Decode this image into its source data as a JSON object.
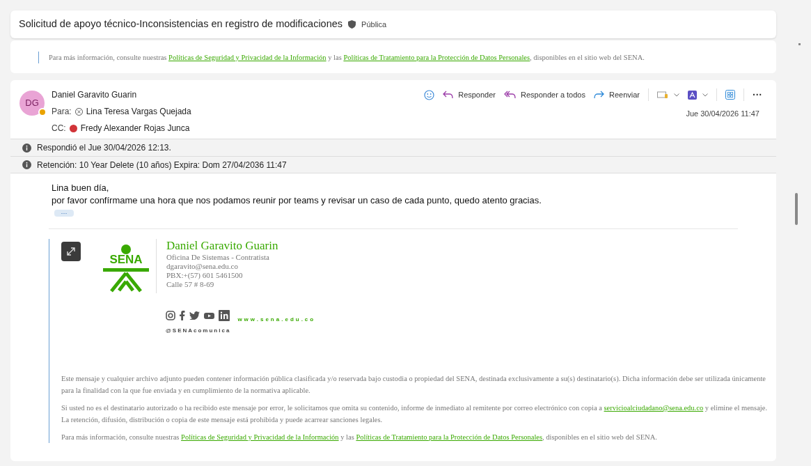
{
  "subject": {
    "title": "Solicitud de apoyo técnico-Inconsistencias en registro de modificaciones",
    "sensitivity": "Pública"
  },
  "previous_message": {
    "paragraphs": [
      {
        "lines": [
          [
            {
              "kind": "text",
              "text": "Para más información, consulte nuestras "
            },
            {
              "kind": "link",
              "text": "Políticas de Seguridad y Privacidad de la Información"
            },
            {
              "kind": "text",
              "text": " y las "
            },
            {
              "kind": "link",
              "text": "Políticas de Tratamiento para la Protección de Datos Personales"
            },
            {
              "kind": "text",
              "text": ", disponibles en el sitio web del SENA."
            }
          ]
        ]
      }
    ]
  },
  "message": {
    "sender": {
      "initials": "DG",
      "name": "Daniel Garavito Guarin",
      "status": {
        "color": "#eaa300"
      }
    },
    "recipients": [
      {
        "label": "Para:",
        "name": "Lina Teresa Vargas Quejada",
        "kind": "offline"
      },
      {
        "label": "CC:",
        "name": "Fredy Alexander Rojas Junca",
        "kind": "dot",
        "color": "#d13438"
      }
    ],
    "actions": [
      {
        "kind": "emoji"
      },
      {
        "kind": "reply",
        "label": "Responder"
      },
      {
        "kind": "reply_all",
        "label": "Responder a todos"
      },
      {
        "kind": "forward",
        "label": "Reenviar"
      },
      {
        "kind": "divider"
      },
      {
        "kind": "label_menu"
      },
      {
        "kind": "pdf_menu"
      },
      {
        "kind": "divider"
      },
      {
        "kind": "apps"
      },
      {
        "kind": "divider"
      },
      {
        "kind": "more",
        "label": "···"
      }
    ],
    "date": "Jue 30/04/2026 11:47",
    "info_bars": [
      "Respondió el Jue 30/04/2026 12:13.",
      "Retención: 10 Year Delete (10 años) Expira: Dom 27/04/2036 11:47"
    ],
    "body": [
      "Lina buen día,",
      "por favor confírmame una hora que nos podamos reunir por teams y revisar un caso de cada punto, quedo atento gracias."
    ],
    "show_more": "···",
    "signature": {
      "name": "Daniel Garavito Guarin",
      "lines": [
        "Oficina De Sistemas - Contratista",
        "dgaravito@sena.edu.co",
        "PBX:+(57) 601 5461500",
        "Calle 57 # 8-69"
      ],
      "logo_text": "SENA",
      "handle": "@SENAcomunica",
      "website": "www.sena.edu.co"
    },
    "disclaimer": [
      {
        "lines": [
          [
            {
              "kind": "text",
              "text": "Este mensaje y cualquier archivo adjunto pueden contener información pública clasificada y/o reservada bajo custodia o propiedad del SENA, destinada exclusivamente a su(s) destinatario(s). Dicha información debe ser utilizada únicamente"
            }
          ],
          [
            {
              "kind": "text",
              "text": "para la finalidad con la que fue enviada y en cumplimiento de la normativa aplicable."
            }
          ]
        ]
      },
      {
        "lines": [
          [
            {
              "kind": "text",
              "text": "Si usted no es el destinatario autorizado o ha recibido este mensaje por error, le solicitamos que omita su contenido, informe de inmediato al remitente por correo electrónico con copia a "
            },
            {
              "kind": "link",
              "text": "servicioalciudadano@sena.edu.co"
            },
            {
              "kind": "text",
              "text": " y elimine el mensaje."
            }
          ],
          [
            {
              "kind": "text",
              "text": "La retención, difusión, distribución o copia de este mensaje está prohibida y puede acarrear sanciones legales."
            }
          ]
        ]
      },
      {
        "lines": [
          [
            {
              "kind": "text",
              "text": "Para más información, consulte nuestras "
            },
            {
              "kind": "link",
              "text": "Políticas de Seguridad y Privacidad de la Información"
            },
            {
              "kind": "text",
              "text": " y las "
            },
            {
              "kind": "link",
              "text": "Políticas de Tratamiento para la Protección de Datos Personales"
            },
            {
              "kind": "text",
              "text": ", disponibles en el sitio web del SENA."
            }
          ]
        ]
      }
    ]
  }
}
